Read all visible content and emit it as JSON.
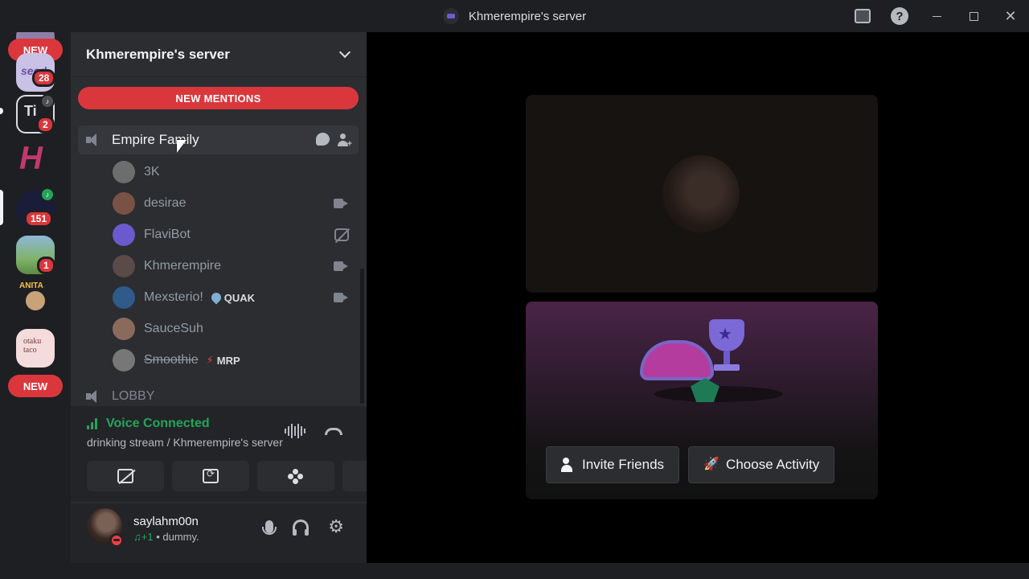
{
  "window": {
    "title": "Khmerempire's server"
  },
  "rail": {
    "new_top": "NEW",
    "new_bottom": "NEW",
    "badges": [
      "28",
      "2",
      "151",
      "1"
    ],
    "servers": [
      "seed",
      "tipsy",
      "hush",
      "dark",
      "landscape",
      "anita",
      "otaku taco"
    ],
    "otaku_label": "otaku\ntaco",
    "anita_label": "ANITA"
  },
  "sidebar": {
    "server_name": "Khmerempire's server",
    "new_mentions": "NEW MENTIONS",
    "voice_channel": "Empire Family",
    "members": [
      {
        "name": "3K",
        "camera": "none",
        "color": "#6d6d6d"
      },
      {
        "name": "desirae",
        "camera": "on",
        "color": "#7a5145"
      },
      {
        "name": "FlaviBot",
        "camera": "off",
        "color": "#6a5acd"
      },
      {
        "name": "Khmerempire",
        "camera": "on",
        "color": "#5a4a48"
      },
      {
        "name": "Mexsterio!",
        "camera": "on",
        "color": "#2f5a8a",
        "tag": "QUAK"
      },
      {
        "name": "SauceSuh",
        "camera": "none",
        "color": "#8a6a5a"
      },
      {
        "name": "Smoothie",
        "camera": "none",
        "color": "#777777",
        "tag": "MRP"
      }
    ],
    "lobby": "LOBBY"
  },
  "voice": {
    "status": "Voice Connected",
    "subtitle": "drinking stream / Khmerempire's server"
  },
  "user": {
    "name": "saylahm00n",
    "status_prefix": "♫+1",
    "status_text": " • dummy."
  },
  "stage": {
    "invite_label": "Invite Friends",
    "activity_label": "Choose Activity"
  },
  "colors": {
    "accent_red": "#da373c",
    "online_green": "#23a559",
    "blurple": "#5865f2"
  }
}
